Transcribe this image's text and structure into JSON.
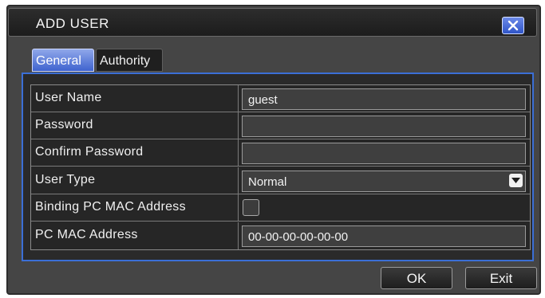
{
  "dialog": {
    "title": "ADD USER"
  },
  "tabs": [
    {
      "label": "General",
      "active": true
    },
    {
      "label": "Authority",
      "active": false
    }
  ],
  "form": {
    "user_name": {
      "label": "User Name",
      "value": "guest"
    },
    "password": {
      "label": "Password",
      "value": ""
    },
    "confirm_password": {
      "label": "Confirm Password",
      "value": ""
    },
    "user_type": {
      "label": "User Type",
      "value": "Normal"
    },
    "binding_pc_mac": {
      "label": "Binding PC MAC Address",
      "checked": false
    },
    "pc_mac_address": {
      "label": "PC MAC Address",
      "value": "00-00-00-00-00-00"
    }
  },
  "buttons": {
    "ok": "OK",
    "exit": "Exit"
  },
  "colors": {
    "accent": "#3b6fd6",
    "window_bg": "#454545",
    "field_bg": "#3f3f3f"
  }
}
